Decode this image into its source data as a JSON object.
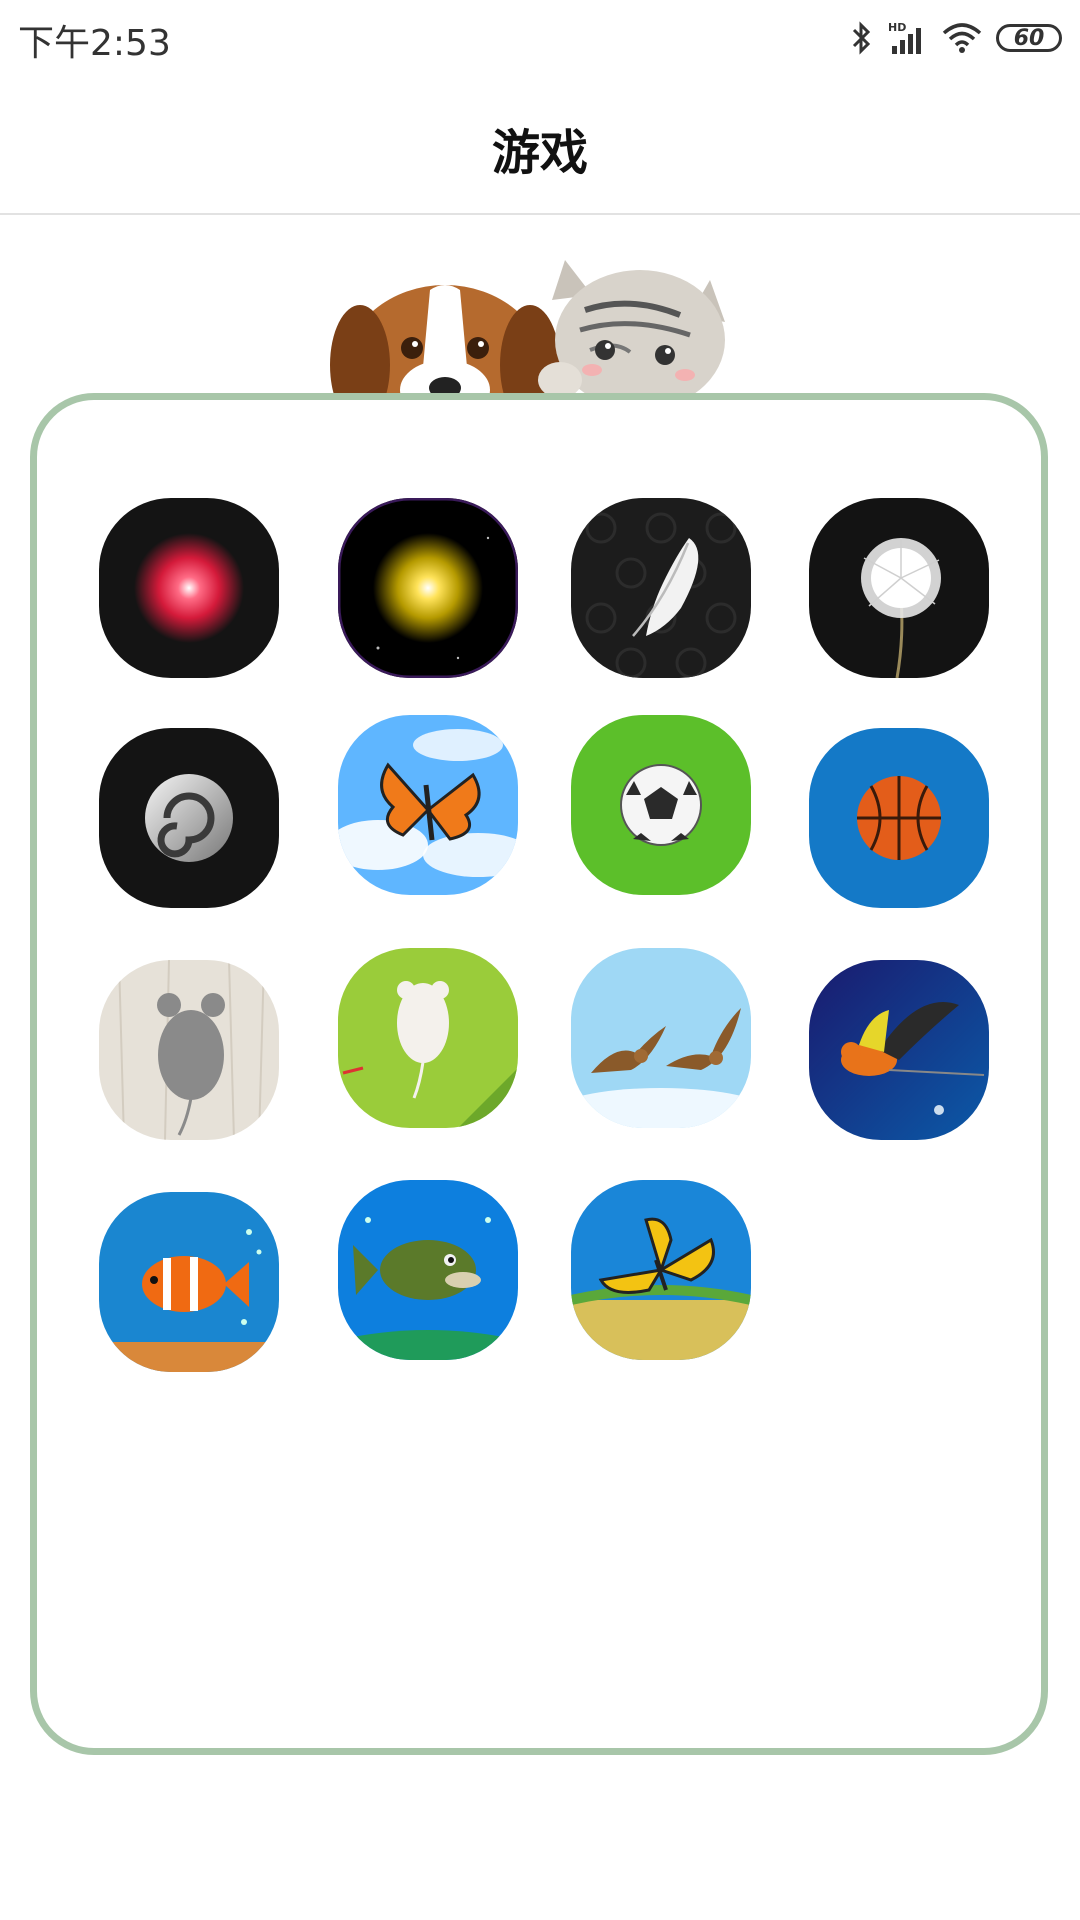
{
  "status_bar": {
    "time": "下午2:53",
    "battery": "60"
  },
  "header": {
    "title": "游戏"
  },
  "games": [
    {
      "icon": "red-light-dot-icon"
    },
    {
      "icon": "yellow-light-dot-icon"
    },
    {
      "icon": "feather-icon"
    },
    {
      "icon": "dandelion-icon"
    },
    {
      "icon": "spiral-icon"
    },
    {
      "icon": "butterfly-sky-icon"
    },
    {
      "icon": "soccer-ball-icon"
    },
    {
      "icon": "basketball-icon"
    },
    {
      "icon": "gray-mouse-icon"
    },
    {
      "icon": "white-mouse-icon"
    },
    {
      "icon": "sparrows-icon"
    },
    {
      "icon": "parrot-icon"
    },
    {
      "icon": "clownfish-icon"
    },
    {
      "icon": "bass-fish-icon"
    },
    {
      "icon": "yellow-butterfly-icon"
    }
  ]
}
